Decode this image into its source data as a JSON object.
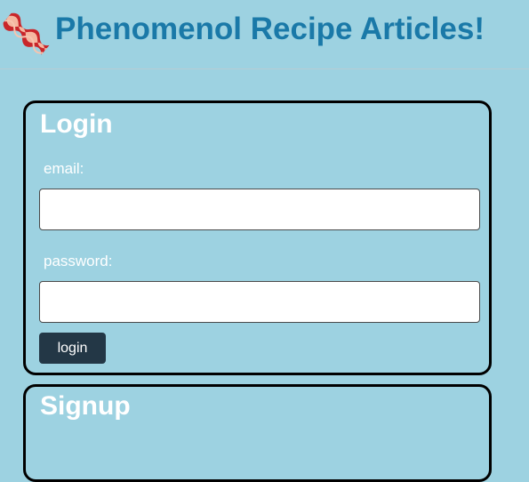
{
  "header": {
    "title": "Phenomenol Recipe Articles!",
    "logo_icon": "bacon-icon"
  },
  "login": {
    "title": "Login",
    "email_label": "email:",
    "email_value": "",
    "password_label": "password:",
    "password_value": "",
    "submit_label": "login"
  },
  "signup": {
    "title": "Signup"
  },
  "colors": {
    "background": "#9dd2e1",
    "title_blue": "#1a79a8",
    "button_dark": "#233746"
  }
}
